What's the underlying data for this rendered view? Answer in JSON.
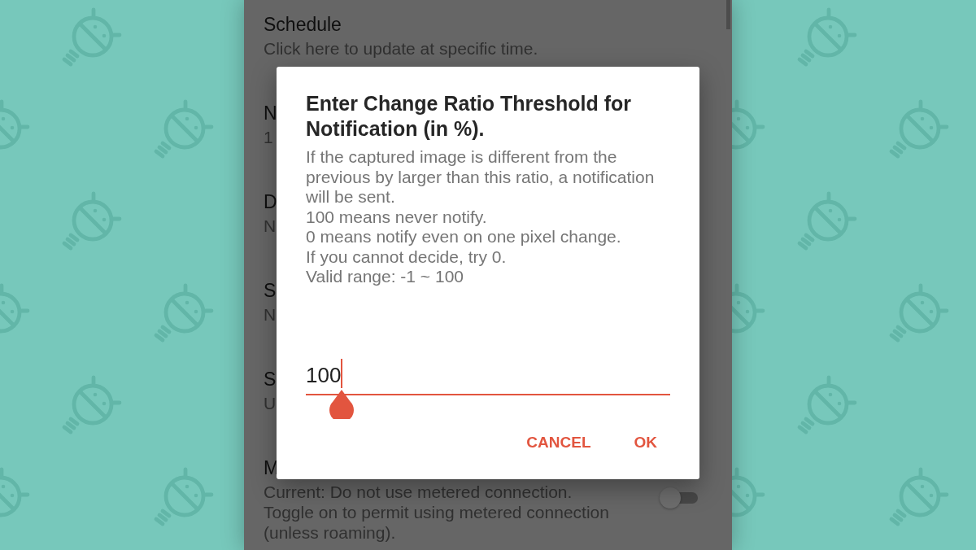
{
  "settings": {
    "items": [
      {
        "kind": "text",
        "title": "Schedule",
        "summary": "Click here to update at specific time."
      },
      {
        "kind": "text",
        "title": "N",
        "summary": "1"
      },
      {
        "kind": "text",
        "title": "D",
        "summary": "N"
      },
      {
        "kind": "text",
        "title": "S",
        "summary": "N"
      },
      {
        "kind": "text",
        "title": "S",
        "summary": "U"
      },
      {
        "kind": "switch",
        "title": "M",
        "summary": "Current: Do not use metered connection.\nToggle on to permit using metered connection (unless roaming).",
        "on": false
      }
    ]
  },
  "dialog": {
    "title": "Enter Change Ratio Threshold for Notification (in %).",
    "message": "If the captured image is different from the previous by larger than this ratio, a notification will be sent.\n100 means never notify.\n0 means notify even on one pixel change.\nIf you cannot decide, try 0.\nValid range: -1 ~ 100",
    "input": {
      "value": "100",
      "focused": true
    },
    "buttons": [
      "CANCEL",
      "OK"
    ]
  }
}
